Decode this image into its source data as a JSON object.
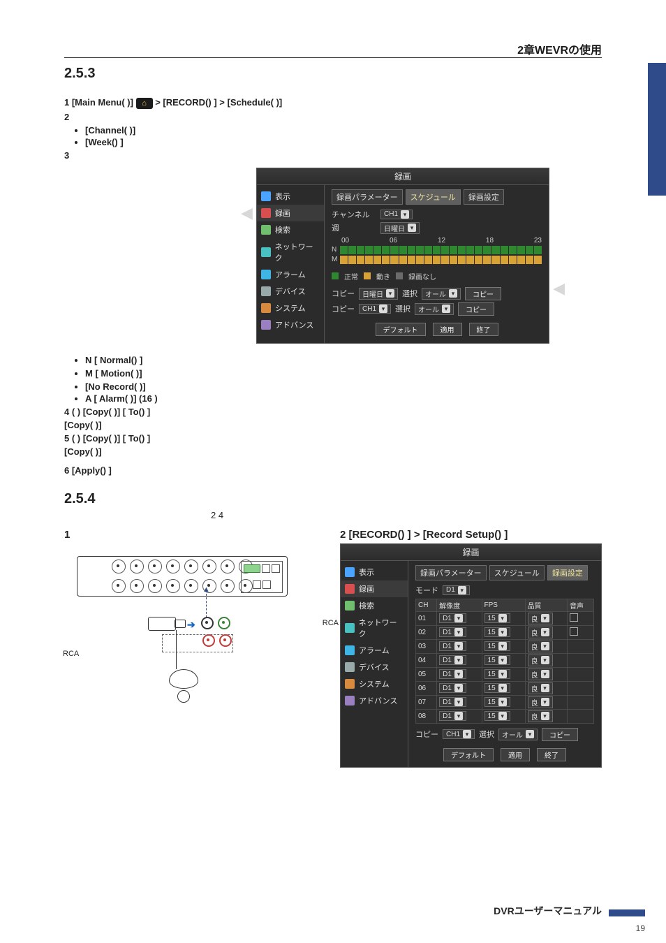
{
  "header": {
    "title": "2章WEVRの使用"
  },
  "section_253": {
    "number": "2.5.3",
    "steps": {
      "s1_prefix": "1 ",
      "s1_a": "[Main Menu(",
      "s1_b": ")] ",
      "s1_c": " > [RECORD()",
      "s1_d": "] > [Schedule(",
      "s1_e": ")]",
      "s2": "2",
      "s2_b1": "[Channel(           )]",
      "s2_b2": "[Week()   ]",
      "s3": "3",
      "bullets_mid": {
        "n": "N  [    Normal()        ]",
        "m": "M  [    Motion(      )]",
        "nr": "[No Record(            )]",
        "a": "A  [    Alarm(          )] (16          )"
      },
      "s4": "4 (              ) [Copy(        )]        [    To()       ]",
      "s4b": "                               [Copy(        )]",
      "s5": "5 (              )          [Copy(        )]        [    To()        ]",
      "s5b": "                                                                          [Copy(        )]",
      "s6": "6 [Apply()     ]"
    },
    "screenshot": {
      "title": "録画",
      "side": [
        "表示",
        "録画",
        "検索",
        "ネットワーク",
        "アラーム",
        "デバイス",
        "システム",
        "アドバンス"
      ],
      "tabs": [
        "録画パラメーター",
        "スケジュール",
        "録画設定"
      ],
      "active_tab": 1,
      "ch_label": "チャンネル",
      "ch_value": "CH1",
      "week_label": "週",
      "week_value": "日曜日",
      "hours": [
        "00",
        "06",
        "12",
        "18",
        "23"
      ],
      "row_labels": [
        "N",
        "M"
      ],
      "legend": {
        "normal": "正常",
        "motion": "動き",
        "norec": "録画なし"
      },
      "copy_week": {
        "copy": "コピー",
        "day": "日曜日",
        "sel": "選択",
        "all": "オール",
        "btn": "コピー"
      },
      "copy_ch": {
        "copy": "コピー",
        "ch": "CH1",
        "sel": "選択",
        "all": "オール",
        "btn": "コピー"
      },
      "buttons": {
        "def": "デフォルト",
        "apply": "適用",
        "exit": "終了"
      }
    }
  },
  "section_254": {
    "number": "2.5.4",
    "subline": "2        4",
    "step1_label": "1",
    "step2": "2 [RECORD()      ] > [Record Setup()           ]",
    "diagram": {
      "rca_a": "RCA",
      "rca_b": "RCA"
    },
    "screenshot": {
      "title": "録画",
      "side": [
        "表示",
        "録画",
        "検索",
        "ネットワーク",
        "アラーム",
        "デバイス",
        "システム",
        "アドバンス"
      ],
      "tabs": [
        "録画パラメーター",
        "スケジュール",
        "録画設定"
      ],
      "active_tab": 2,
      "mode_label": "モード",
      "mode_value": "D1",
      "headers": {
        "ch": "CH",
        "res": "解像度",
        "fps": "FPS",
        "quality": "品質",
        "audio": "音声"
      },
      "rows": [
        {
          "ch": "01",
          "res": "D1",
          "fps": "15",
          "q": "良"
        },
        {
          "ch": "02",
          "res": "D1",
          "fps": "15",
          "q": "良"
        },
        {
          "ch": "03",
          "res": "D1",
          "fps": "15",
          "q": "良"
        },
        {
          "ch": "04",
          "res": "D1",
          "fps": "15",
          "q": "良"
        },
        {
          "ch": "05",
          "res": "D1",
          "fps": "15",
          "q": "良"
        },
        {
          "ch": "06",
          "res": "D1",
          "fps": "15",
          "q": "良"
        },
        {
          "ch": "07",
          "res": "D1",
          "fps": "15",
          "q": "良"
        },
        {
          "ch": "08",
          "res": "D1",
          "fps": "15",
          "q": "良"
        }
      ],
      "copy": {
        "copy": "コピー",
        "ch": "CH1",
        "sel": "選択",
        "all": "オール",
        "btn": "コピー"
      },
      "buttons": {
        "def": "デフォルト",
        "apply": "適用",
        "exit": "終了"
      }
    }
  },
  "footer": {
    "label": "DVRユーザーマニュアル",
    "page": "19"
  }
}
